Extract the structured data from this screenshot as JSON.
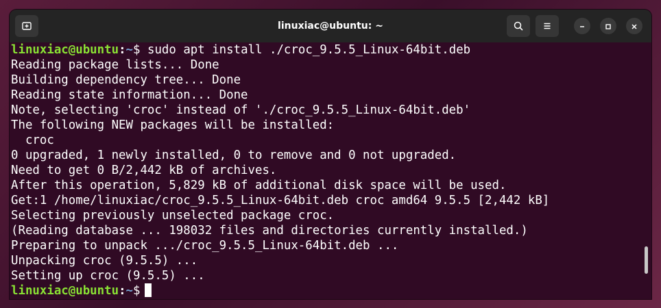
{
  "window": {
    "title": "linuxiac@ubuntu: ~"
  },
  "titlebar": {
    "new_tab_icon": "new-tab-icon",
    "search_icon": "search-icon",
    "menu_icon": "hamburger-menu-icon",
    "minimize_icon": "minimize-icon",
    "maximize_icon": "maximize-icon",
    "close_icon": "close-icon"
  },
  "colors": {
    "terminal_bg": "#300a24",
    "titlebar_bg": "#242424",
    "prompt_user": "#8ae234",
    "prompt_path": "#729fcf",
    "text": "#ffffff"
  },
  "terminal": {
    "prompt_user_host": "linuxiac@ubuntu",
    "prompt_separator": ":",
    "prompt_path": "~",
    "prompt_sign": "$",
    "command": " sudo apt install ./croc_9.5.5_Linux-64bit.deb",
    "output": [
      "Reading package lists... Done",
      "Building dependency tree... Done",
      "Reading state information... Done",
      "Note, selecting 'croc' instead of './croc_9.5.5_Linux-64bit.deb'",
      "The following NEW packages will be installed:",
      "  croc",
      "0 upgraded, 1 newly installed, 0 to remove and 0 not upgraded.",
      "Need to get 0 B/2,442 kB of archives.",
      "After this operation, 5,829 kB of additional disk space will be used.",
      "Get:1 /home/linuxiac/croc_9.5.5_Linux-64bit.deb croc amd64 9.5.5 [2,442 kB]",
      "Selecting previously unselected package croc.",
      "(Reading database ... 198032 files and directories currently installed.)",
      "Preparing to unpack .../croc_9.5.5_Linux-64bit.deb ...",
      "Unpacking croc (9.5.5) ...",
      "Setting up croc (9.5.5) ..."
    ]
  }
}
